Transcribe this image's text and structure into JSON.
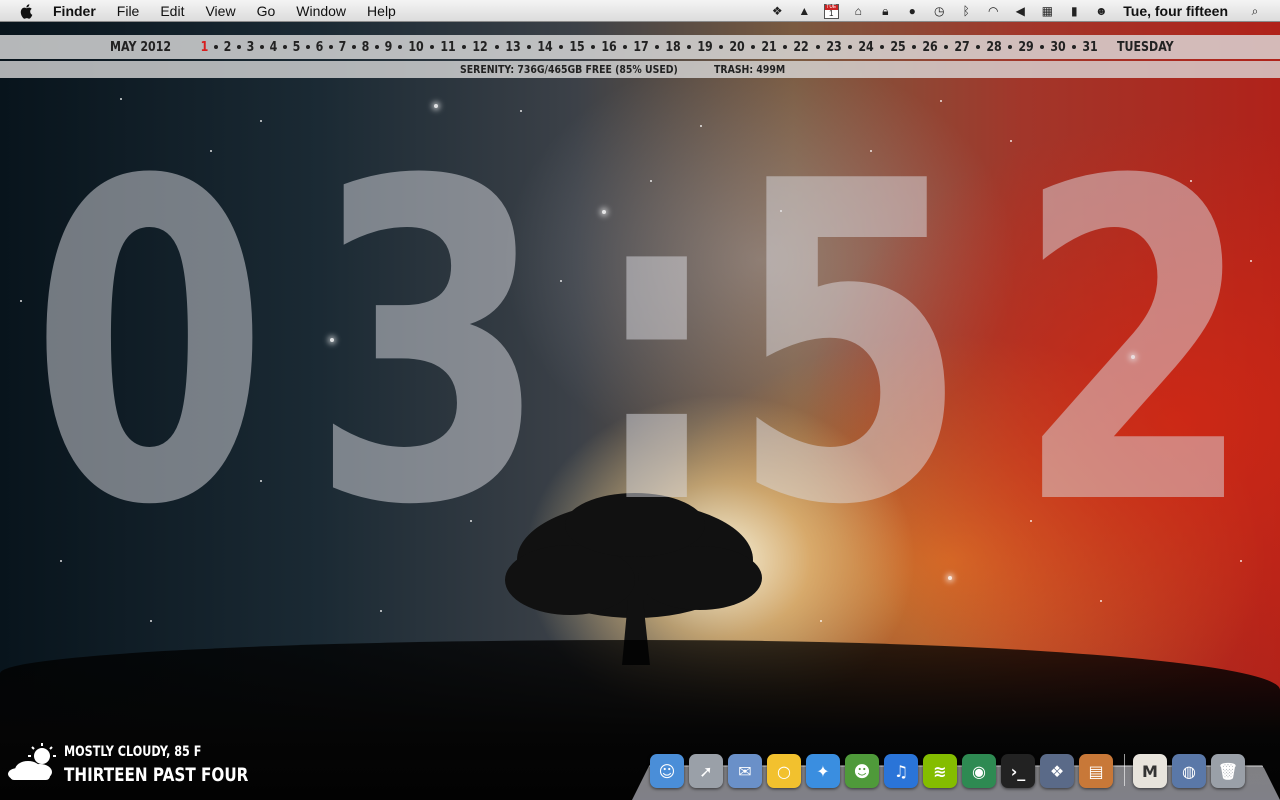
{
  "menubar": {
    "app_name": "Finder",
    "menus": [
      "File",
      "Edit",
      "View",
      "Go",
      "Window",
      "Help"
    ],
    "clock": "Tue, four fifteen",
    "calendar_icon_day": "1",
    "calendar_icon_month": "TUE",
    "status_icons": [
      "dropbox-icon",
      "google-drive-icon",
      "calendar-icon",
      "home-icon",
      "lock-icon",
      "circle-icon",
      "time-machine-icon",
      "bluetooth-icon",
      "wifi-icon",
      "volume-icon",
      "us-flag-icon",
      "battery-icon",
      "user-icon",
      "spotlight-icon"
    ]
  },
  "calendar_strip": {
    "month": "MAY 2012",
    "days": [
      "1",
      "2",
      "3",
      "4",
      "5",
      "6",
      "7",
      "8",
      "9",
      "10",
      "11",
      "12",
      "13",
      "14",
      "15",
      "16",
      "17",
      "18",
      "19",
      "20",
      "21",
      "22",
      "23",
      "24",
      "25",
      "26",
      "27",
      "28",
      "29",
      "30",
      "31"
    ],
    "today": "1",
    "weekday": "TUESDAY",
    "today_color": "#d81e1e"
  },
  "disk_strip": {
    "disk": "SERENITY: 736G/465GB FREE (85% USED)",
    "trash": "TRASH: 499M"
  },
  "big_clock": {
    "digit1": "0",
    "digit2": "3",
    "colon": ":",
    "digit3": "5",
    "digit4": "2"
  },
  "weather": {
    "condition": "MOSTLY CLOUDY, 85 F",
    "time_words": "THIRTEEN PAST FOUR",
    "icon": "partly-cloudy-icon"
  },
  "dock": {
    "apps": [
      {
        "name": "finder-icon",
        "color": "#4a8ed8",
        "glyph": "☺"
      },
      {
        "name": "launchpad-icon",
        "color": "#9aa0a8",
        "glyph": "➚"
      },
      {
        "name": "mail-icon",
        "color": "#6a90c8",
        "glyph": "✉"
      },
      {
        "name": "chrome-icon",
        "color": "#f2c12e",
        "glyph": "○"
      },
      {
        "name": "safari-icon",
        "color": "#3a8ee0",
        "glyph": "✦"
      },
      {
        "name": "adium-icon",
        "color": "#4f9a3a",
        "glyph": "☻"
      },
      {
        "name": "itunes-icon",
        "color": "#2a74d8",
        "glyph": "♫"
      },
      {
        "name": "spotify-icon",
        "color": "#84bd00",
        "glyph": "≋"
      },
      {
        "name": "cyberduck-icon",
        "color": "#2e8a52",
        "glyph": "◉"
      },
      {
        "name": "terminal-icon",
        "color": "#222222",
        "glyph": "›_"
      },
      {
        "name": "iphoto-icon",
        "color": "#5a6a88",
        "glyph": "❖"
      },
      {
        "name": "keynote-icon",
        "color": "#c87838",
        "glyph": "▤"
      }
    ],
    "trailing": [
      {
        "name": "mal-icon",
        "color": "#e8e4dc",
        "glyph": "M"
      },
      {
        "name": "downloads-stack-icon",
        "color": "#5a78a8",
        "glyph": "◍"
      },
      {
        "name": "trash-icon",
        "color": "#9aa0a8",
        "glyph": "🗑"
      }
    ]
  }
}
